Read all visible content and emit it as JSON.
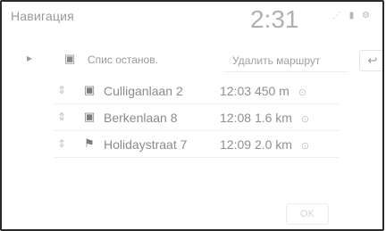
{
  "header": {
    "title": "Навигация",
    "clock": "2:31",
    "status_icons": [
      "signal-icon",
      "battery-icon",
      "settings-icon"
    ],
    "status_glyphs": "⋰ ▮ ⚙"
  },
  "toolbar": {
    "stop_list_label": "Спис останов.",
    "delete_route_label": "Удалить маршрут",
    "return_glyph": "↩"
  },
  "stops": [
    {
      "name": "Culliganlaan 2",
      "time": "12:03",
      "distance": "450 m",
      "icon": "building-icon",
      "glyph": "▣"
    },
    {
      "name": "Berkenlaan 8",
      "time": "12:08",
      "distance": "1.6 km",
      "icon": "building-icon",
      "glyph": "▣"
    },
    {
      "name": "Holidaystraat 7",
      "time": "12:09",
      "distance": "2.0 km",
      "icon": "destination-flag-icon",
      "glyph": "⚑"
    }
  ],
  "footer": {
    "ok_label": "OK"
  }
}
